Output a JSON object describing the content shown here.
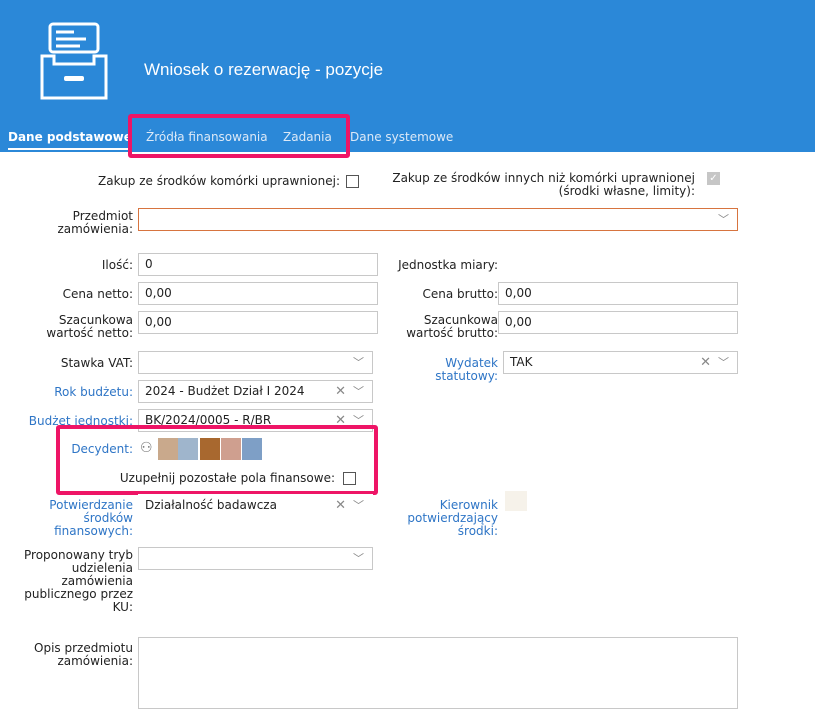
{
  "header": {
    "title": "Wniosek o rezerwację - pozycje"
  },
  "tabs": [
    {
      "label": "Dane podstawowe"
    },
    {
      "label": "Źródła finansowania"
    },
    {
      "label": "Zadania"
    },
    {
      "label": "Dane systemowe"
    }
  ],
  "form": {
    "zakup_ku_label": "Zakup ze środków komórki uprawnionej:",
    "zakup_inne_label": "Zakup ze środków innych niż komórki uprawnionej (środki własne, limity):",
    "zakup_ku_checked": false,
    "zakup_inne_checked": true,
    "przedmiot_label": "Przedmiot zamówienia:",
    "przedmiot_value": "",
    "ilosc_label": "Ilość:",
    "ilosc_value": "0",
    "jednostka_label": "Jednostka miary:",
    "cena_netto_label": "Cena netto:",
    "cena_netto_value": "0,00",
    "cena_brutto_label": "Cena brutto:",
    "cena_brutto_value": "0,00",
    "szac_netto_label": "Szacunkowa wartość netto:",
    "szac_netto_value": "0,00",
    "szac_brutto_label": "Szacunkowa wartość brutto:",
    "szac_brutto_value": "0,00",
    "stawka_vat_label": "Stawka VAT:",
    "stawka_vat_value": "",
    "wydatek_label": "Wydatek statutowy:",
    "wydatek_value": "TAK",
    "rok_label": "Rok budżetu:",
    "rok_value": "2024 - Budżet Dział I 2024",
    "budzet_label": "Budżet jednostki:",
    "budzet_value": "BK/2024/0005 - R/BR",
    "decydent_label": "Decydent:",
    "uzupelnij_label": "Uzupełnij pozostałe pola finansowe:",
    "uzupelnij_checked": false,
    "potwierdzanie_label": "Potwierdzanie środków finansowych:",
    "potwierdzanie_value": "Działalność badawcza",
    "kierownik_label": "Kierownik potwierdzający środki:",
    "tryb_label": "Proponowany tryb udzielenia zamówienia publicznego przez KU:",
    "tryb_value": "",
    "opis_label": "Opis przedmiotu zamówienia:",
    "opis_value": ""
  },
  "icons": {
    "chevron": "chevron-down-icon",
    "clear": "clear-icon",
    "check": "check-icon",
    "person": "person-icon",
    "logo": "drawer-icon"
  },
  "colors": {
    "header_bg": "#2b88d8",
    "highlight": "#ee1566",
    "link": "#2e75c6",
    "error_border": "#d7743f",
    "swatches": [
      "#c9a98c",
      "#9fb5cc",
      "#a8682f",
      "#cf9f8f",
      "#7e9fc6"
    ]
  }
}
